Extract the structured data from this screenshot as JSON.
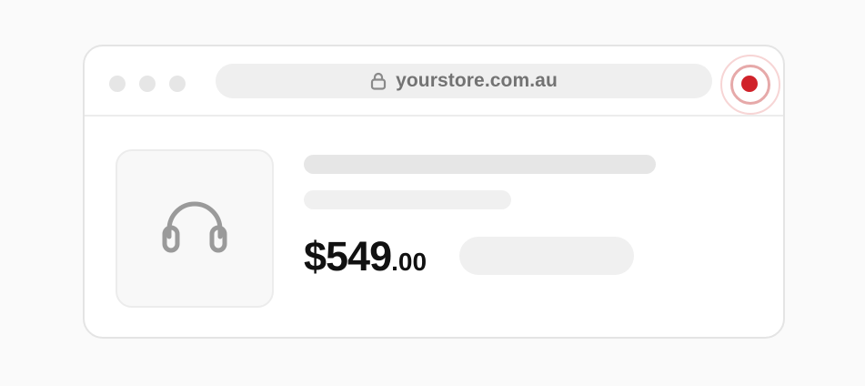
{
  "browser": {
    "url": "yourstore.com.au",
    "window_dots": [
      "dot-1",
      "dot-2",
      "dot-3"
    ],
    "record_icon": "record-icon",
    "lock_icon": "lock-icon"
  },
  "product": {
    "image_icon": "headphones-icon",
    "price_main": "$549",
    "price_cents": ".00"
  },
  "colors": {
    "record_red": "#d0222a",
    "icon_gray": "#9a9a9a",
    "price_text": "#111111",
    "url_text": "#737373"
  }
}
